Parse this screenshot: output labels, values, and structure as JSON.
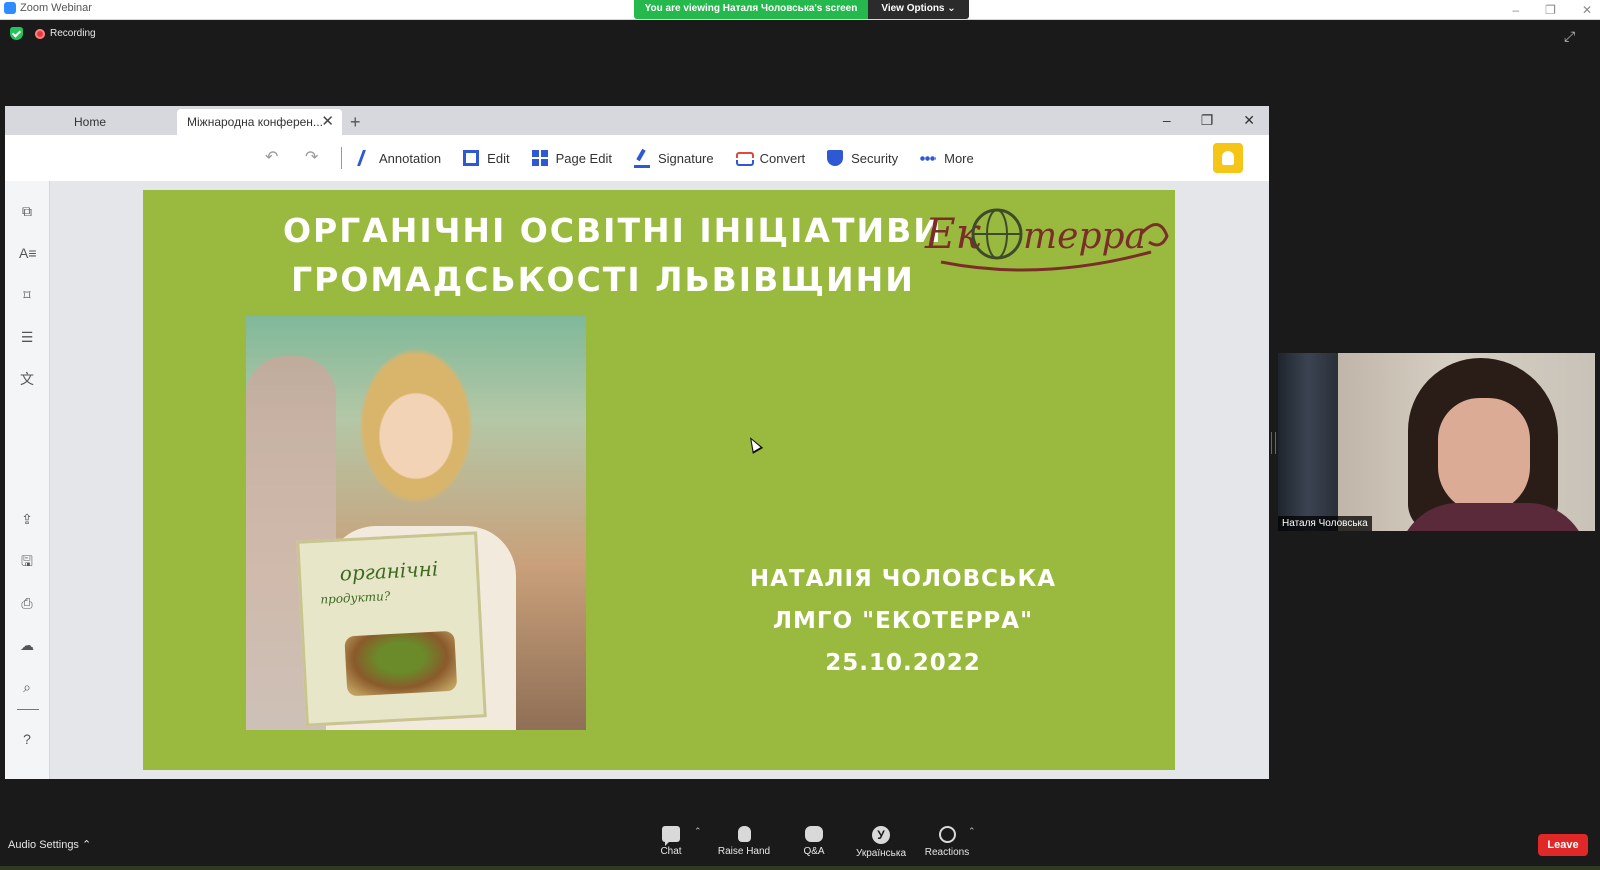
{
  "zoom": {
    "app_title": "Zoom Webinar",
    "viewing_banner": "You are viewing Наталя Чоловська's screen",
    "view_options": "View Options",
    "recording_label": "Recording",
    "window_controls": [
      "–",
      "❐",
      "✕"
    ]
  },
  "pdf": {
    "tabs": [
      {
        "label": "Home"
      },
      {
        "label": "Міжнародна конферен..."
      }
    ],
    "toolbar": {
      "annotation": "Annotation",
      "edit": "Edit",
      "page_edit": "Page Edit",
      "signature": "Signature",
      "convert": "Convert",
      "security": "Security",
      "more": "More"
    }
  },
  "slide": {
    "title_line1": "ОРГАНІЧНІ ОСВІТНІ ІНІЦІАТИВИ",
    "title_line2": "ГРОМАДСЬКОСТІ ЛЬВІВЩИНИ",
    "logo_text": "Екотерра",
    "book_title": "органічні",
    "book_subtitle": "продукти?",
    "author": "НАТАЛІЯ ЧОЛОВСЬКА",
    "organization": "ЛМГО \"ЕКОТЕРРА\"",
    "date": "25.10.2022"
  },
  "participant": {
    "name": "Наталя Чоловська"
  },
  "controls": {
    "audio_settings": "Audio Settings",
    "chat": "Chat",
    "raise_hand": "Raise Hand",
    "qa": "Q&A",
    "language": "Українська",
    "language_badge": "У",
    "reactions": "Reactions",
    "leave": "Leave"
  }
}
